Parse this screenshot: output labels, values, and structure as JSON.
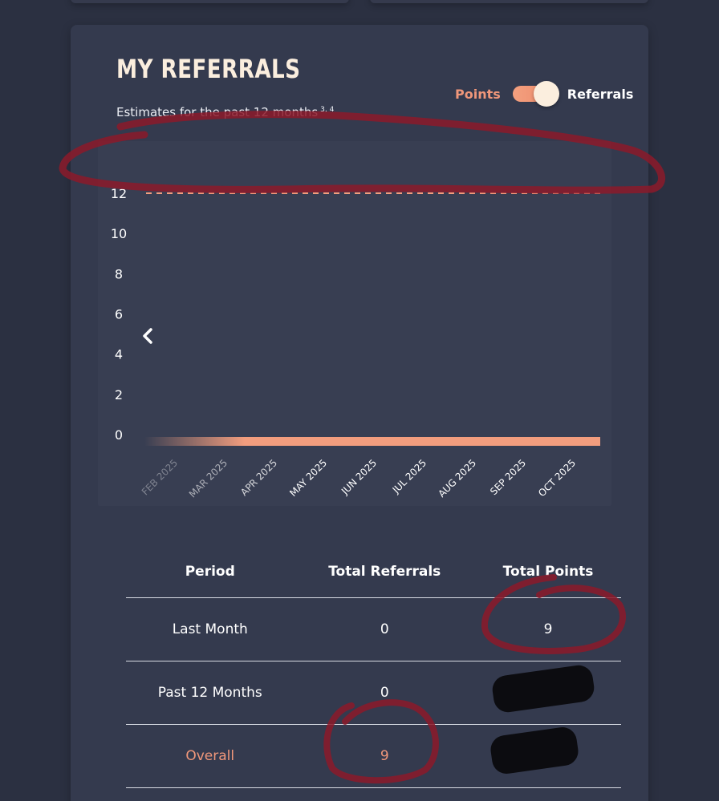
{
  "card": {
    "title": "MY REFERRALS",
    "subtitle": "Estimates for the past 12 months",
    "subtitle_footnotes": "3, 4"
  },
  "toggle": {
    "left_label": "Points",
    "right_label": "Referrals",
    "selected": "Referrals"
  },
  "chart_data": {
    "type": "bar",
    "title": "",
    "xlabel": "",
    "ylabel": "",
    "categories": [
      "FEB 2025",
      "MAR 2025",
      "APR 2025",
      "MAY 2025",
      "JUN 2025",
      "JUL 2025",
      "AUG 2025",
      "SEP 2025",
      "OCT 2025"
    ],
    "values": [
      0,
      0,
      0,
      0,
      0,
      0,
      0,
      0,
      0
    ],
    "ylim": [
      0,
      12
    ],
    "yticks": [
      0,
      2,
      4,
      6,
      8,
      10,
      12
    ],
    "grid": true,
    "scroll_left_icon": "chevron-left-icon",
    "bar_color": "#f29d7e",
    "grid_color": "#c9ccd6"
  },
  "table": {
    "headers": [
      "Period",
      "Total Referrals",
      "Total Points"
    ],
    "rows": [
      {
        "period": "Last Month",
        "referrals": "0",
        "points": "9"
      },
      {
        "period": "Past 12 Months",
        "referrals": "0",
        "points": ""
      },
      {
        "period": "Overall",
        "referrals": "9",
        "points": ""
      }
    ]
  },
  "colors": {
    "background": "#2b3041",
    "card": "#343a4e",
    "accent": "#f0977a",
    "title": "#fbeede",
    "annotation_marker": "#8c1a2a",
    "redaction": "#0c0c10"
  }
}
